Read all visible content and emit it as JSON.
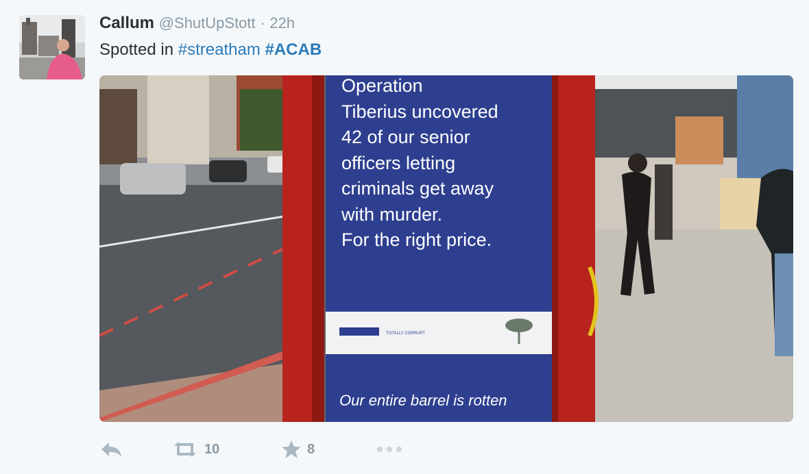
{
  "tweet": {
    "author_name": "Callum",
    "handle": "@ShutUpStott",
    "separator": "·",
    "time": "22h",
    "text_prefix": "Spotted in",
    "hashtag1": "#streatham",
    "hashtag2": "#ACAB"
  },
  "poster": {
    "body": "Operation\nTiberius uncovered\n42 of our senior\nofficers letting\ncriminals get away\nwith murder.\nFor the right price.",
    "strip_text": "TOTALLY CORRUPT",
    "footer": "Our entire barrel is rotten"
  },
  "actions": {
    "retweet_count": "10",
    "favorite_count": "8"
  },
  "colors": {
    "background": "#f5f8fa",
    "hashtag": "#2b7bb9",
    "poster_blue": "#2e3f8f",
    "booth_red": "#b8231d"
  }
}
